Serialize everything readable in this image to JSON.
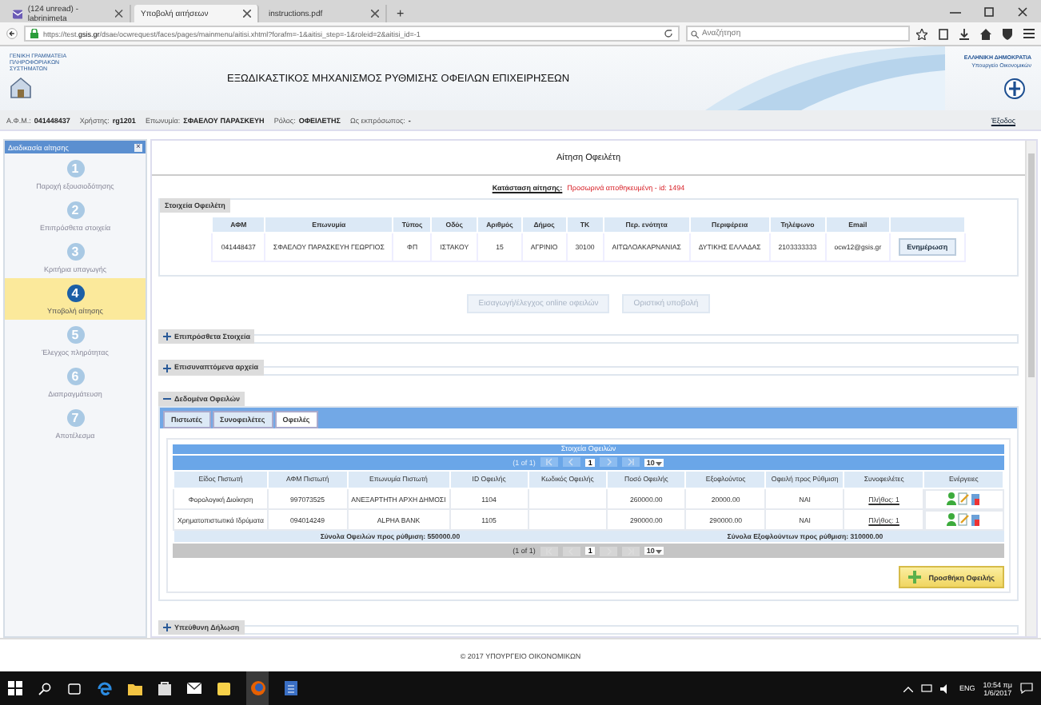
{
  "browser": {
    "tabs": [
      {
        "label": "(124 unread) - labrinimeta",
        "selected": false,
        "kind": "mail"
      },
      {
        "label": "Υποβολή αιτήσεων",
        "selected": true,
        "kind": "page"
      },
      {
        "label": "instructions.pdf",
        "selected": false,
        "kind": "page"
      }
    ],
    "new_tab": "+",
    "url_prefix": "https://test.",
    "url_domain": "gsis.gr",
    "url_rest": "/dsae/ocwrequest/faces/pages/mainmenu/aitisi.xhtml?forafm=-1&aitisi_step=-1&roleid=2&aitisi_id=-1",
    "search": {
      "placeholder": "Αναζήτηση"
    }
  },
  "header": {
    "org": "ΓΕΝΙΚΗ ΓΡΑΜΜΑΤΕΙΑ ΠΛΗΡΟΦΟΡΙΑΚΩΝ ΣΥΣΤΗΜΑΤΩΝ",
    "title": "ΕΞΩΔΙΚΑΣΤΙΚΟΣ ΜΗΧΑΝΙΣΜΟΣ ΡΥΘΜΙΣΗΣ ΟΦΕΙΛΩΝ ΕΠΙΧΕΙΡΗΣΕΩΝ",
    "state": "ΕΛΛΗΝΙΚΗ ΔΗΜΟΚΡΑΤΙΑ",
    "ministry": "Υπουργείο Οικονομικών"
  },
  "user_bar": {
    "fields": [
      {
        "label": "Α.Φ.Μ.:",
        "value": "041448437"
      },
      {
        "label": "Χρήστης:",
        "value": "rg1201"
      },
      {
        "label": "Επωνυμία:",
        "value": "ΣΦΑΕΛΟΥ ΠΑΡΑΣΚΕΥΗ"
      },
      {
        "label": "Ρόλος:",
        "value": "ΟΦΕΙΛΕΤΗΣ"
      },
      {
        "label": "Ως εκπρόσωπος:",
        "value": "-"
      }
    ],
    "logout": "Έξοδος"
  },
  "sidebar": {
    "title": "Διαδικασία αίτησης",
    "close": "×",
    "steps": [
      {
        "number": "1",
        "label": "Παροχή εξουσιοδότησης",
        "selected": false
      },
      {
        "number": "2",
        "label": "Επιπρόσθετα στοιχεία",
        "selected": false
      },
      {
        "number": "3",
        "label": "Κριτήρια υπαγωγής",
        "selected": false
      },
      {
        "number": "4",
        "label": "Υποβολή αίτησης",
        "selected": true
      },
      {
        "number": "5",
        "label": "Έλεγχος πληρότητας",
        "selected": false
      },
      {
        "number": "6",
        "label": "Διαπραγμάτευση",
        "selected": false
      },
      {
        "number": "7",
        "label": "Αποτέλεσμα",
        "selected": false
      }
    ]
  },
  "main": {
    "title": "Αίτηση Οφειλέτη",
    "status_label": "Κατάσταση αίτησης:",
    "status_value": "Προσωρινά αποθηκευμένη - id: 1494",
    "debtor": {
      "legend": "Στοιχεία Οφειλέτη",
      "columns": [
        "ΑΦΜ",
        "Επωνυμία",
        "Τύπος",
        "Οδός",
        "Αριθμός",
        "Δήμος",
        "ΤΚ",
        "Περ. ενότητα",
        "Περιφέρεια",
        "Τηλέφωνο",
        "Email"
      ],
      "row": [
        "041448437",
        "ΣΦΑΕΛΟΥ ΠΑΡΑΣΚΕΥΗ ΓΕΩΡΓΙΟΣ",
        "ΦΠ",
        "ΙΣΤΑΚΟΥ",
        "15",
        "ΑΓΡΙΝΙΟ",
        "30100",
        "ΑΙΤΩΛΟΑΚΑΡΝΑΝΙΑΣ",
        "ΔΥΤΙΚΗΣ ΕΛΛΑΔΑΣ",
        "2103333333",
        "ocw12@gsis.gr"
      ],
      "update_button": "Ενημέρωση"
    },
    "actions": [
      {
        "label": "Εισαγωγή/έλεγχος online οφειλών",
        "disabled": true
      },
      {
        "label": "Οριστική υποβολή",
        "disabled": true
      }
    ],
    "sections_before": [
      {
        "label": "Επιπρόσθετα Στοιχεία",
        "expanded": false
      },
      {
        "label": "Επισυναπτόμενα αρχεία",
        "expanded": false
      }
    ],
    "debts_section": {
      "label": "Δεδομένα Οφειλών",
      "expanded": true,
      "tabs": [
        {
          "label": "Πιστωτές",
          "selected": false
        },
        {
          "label": "Συνοφειλέτες",
          "selected": false
        },
        {
          "label": "Οφειλές",
          "selected": true
        }
      ],
      "table": {
        "title": "Στοιχεία Οφειλών",
        "pager": {
          "summary": "(1 of 1)",
          "page": "1",
          "page_size": "10"
        },
        "columns": [
          "Είδος Πιστωτή",
          "ΑΦΜ Πιστωτή",
          "Επωνυμία Πιστωτή",
          "ID Οφειλής",
          "Κωδικός Οφειλής",
          "Ποσό Οφειλής",
          "Εξοφλούντος",
          "Οφειλή προς Ρύθμιση",
          "Συνοφειλέτες",
          "Ενέργειες"
        ],
        "rows": [
          {
            "creditor_type": "Φορολογική Διοίκηση",
            "creditor_afm": "997073525",
            "creditor_name": "ΑΝΕΞΑΡΤΗΤΗ ΑΡΧΗ ΔΗΜΟΣΙ",
            "debt_id": "1104",
            "amount": "260000.00",
            "paid": "20000.00",
            "to_settle": "ΝΑΙ",
            "co_debtors": "Πλήθος: 1"
          },
          {
            "creditor_type": "Χρηματοπιστωτικά Ιδρύματα",
            "creditor_afm": "094014249",
            "creditor_name": "ALPHA BANK",
            "debt_id": "1105",
            "amount": "290000.00",
            "paid": "290000.00",
            "to_settle": "ΝΑΙ",
            "co_debtors": "Πλήθος: 1"
          }
        ],
        "totals": [
          "Σύνολα Οφειλών προς ρύθμιση: 550000.00",
          "Σύνολα Εξοφλούντων προς ρύθμιση: 310000.00"
        ],
        "bottom_pager": {
          "summary": "(1 of 1)",
          "page": "1",
          "page_size": "10"
        }
      },
      "add_button": "Προσθήκη Οφειλής"
    },
    "sections_after": [
      {
        "label": "Υπεύθυνη Δήλωση",
        "expanded": false
      }
    ]
  },
  "footer": "© 2017 ΥΠΟΥΡΓΕΙΟ ΟΙΚΟΝΟΜΙΚΩΝ",
  "taskbar": {
    "language": "ENG",
    "time": "10:54 πμ",
    "date": "1/6/2017"
  }
}
